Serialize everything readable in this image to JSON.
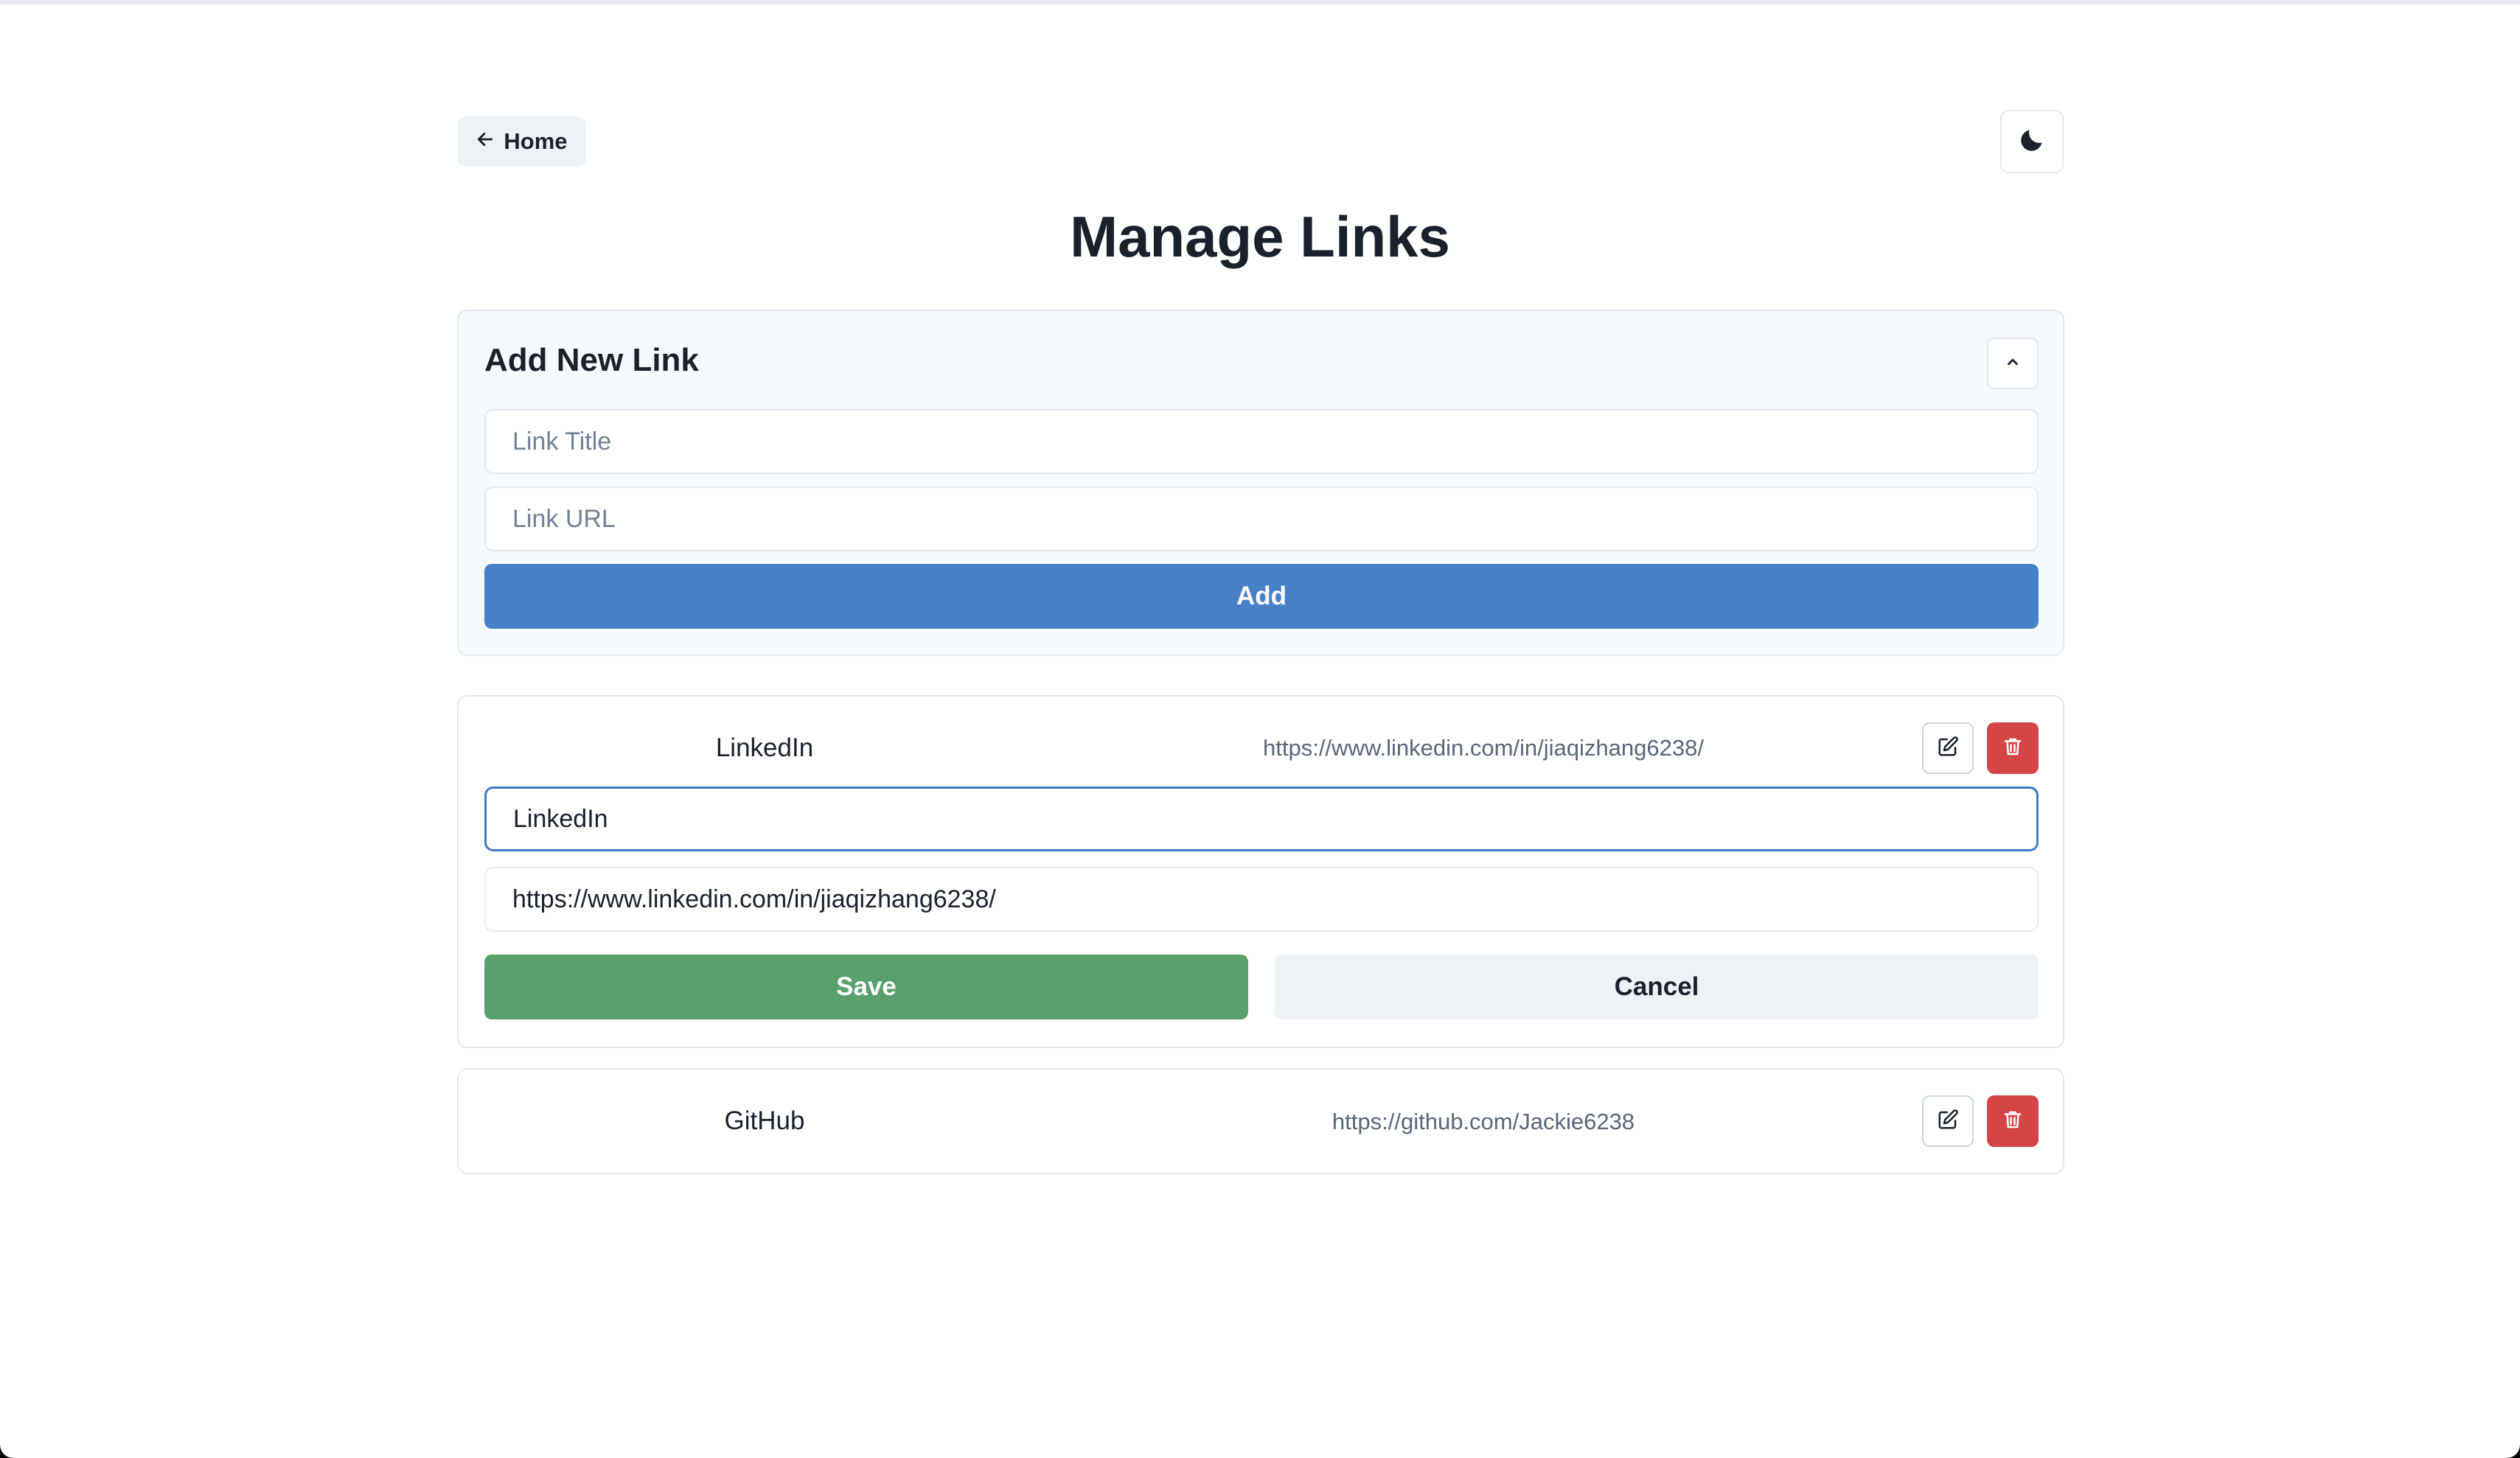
{
  "nav": {
    "home_label": "Home",
    "home_icon": "arrow-left-icon",
    "theme_icon": "moon-icon"
  },
  "page": {
    "title": "Manage Links"
  },
  "add_link": {
    "heading": "Add New Link",
    "collapse_icon": "chevron-up-icon",
    "title_placeholder": "Link Title",
    "title_value": "",
    "url_placeholder": "Link URL",
    "url_value": "",
    "add_label": "Add"
  },
  "links": [
    {
      "title": "LinkedIn",
      "url": "https://www.linkedin.com/in/jiaqizhang6238/",
      "editing": true,
      "edit_title_value": "LinkedIn",
      "edit_url_value": "https://www.linkedin.com/in/jiaqizhang6238/",
      "save_label": "Save",
      "cancel_label": "Cancel"
    },
    {
      "title": "GitHub",
      "url": "https://github.com/Jackie6238",
      "editing": false
    }
  ],
  "icons": {
    "edit": "edit-icon",
    "delete": "trash-icon"
  },
  "colors": {
    "primary": "#4880c8",
    "success": "#58a06c",
    "danger": "#d64545",
    "focus_border": "#3f7bc6",
    "muted_bg": "#edf2f7",
    "card_bg": "#f7fafc"
  }
}
